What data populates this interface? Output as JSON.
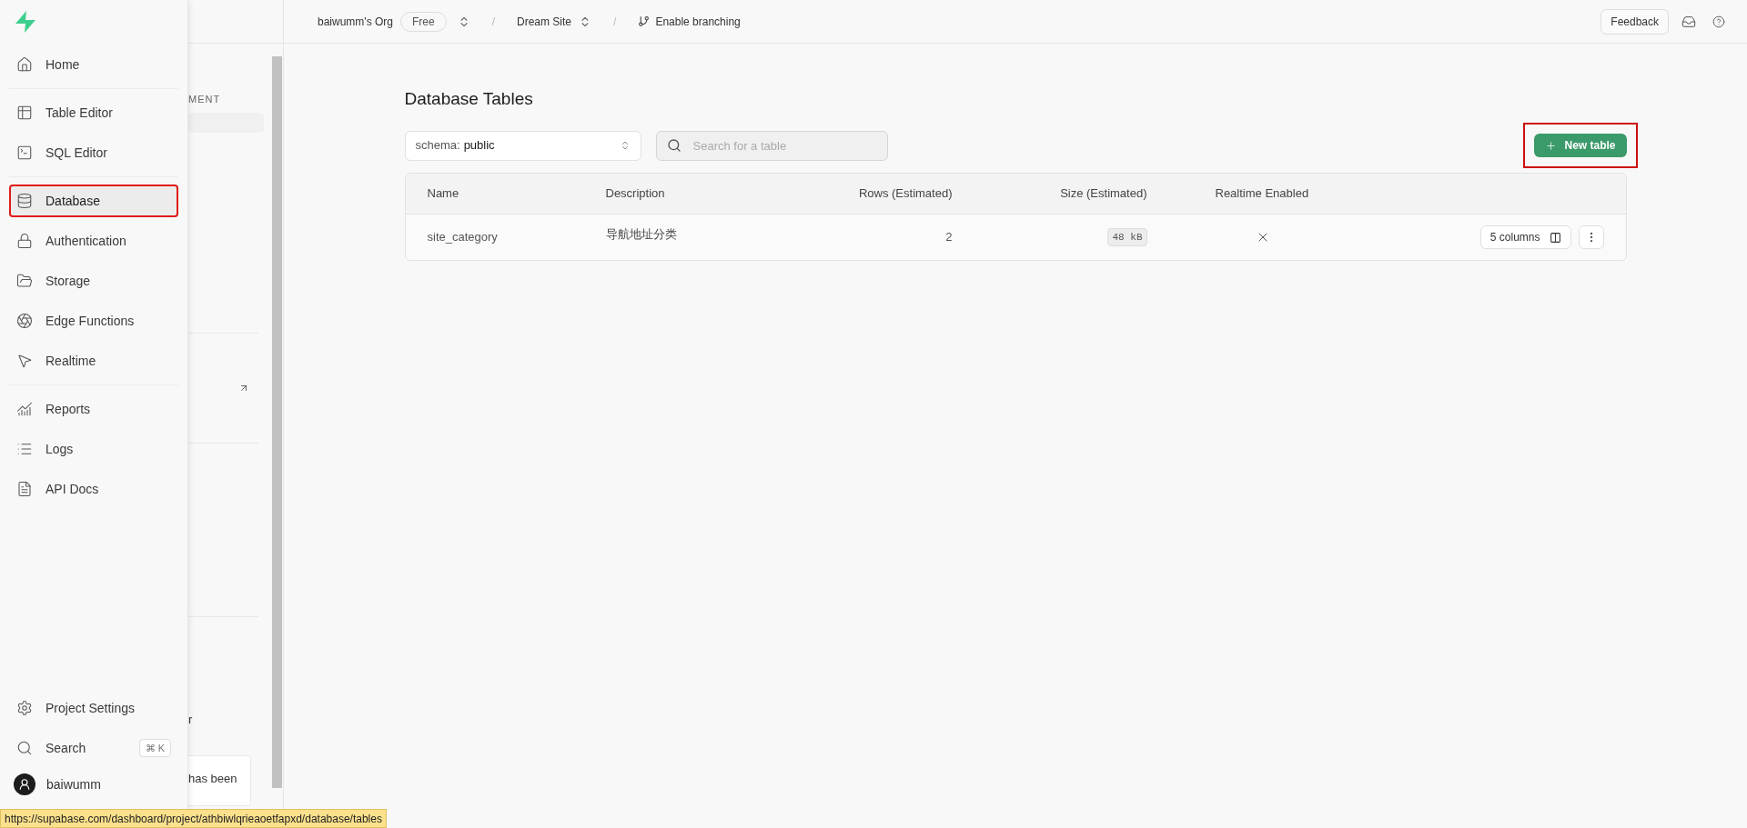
{
  "sidebar": {
    "groups": [
      [
        {
          "label": "Home",
          "selected": false,
          "outlined": false
        }
      ],
      [
        {
          "label": "Table Editor",
          "selected": false,
          "outlined": false
        },
        {
          "label": "SQL Editor",
          "selected": false,
          "outlined": false
        }
      ],
      [
        {
          "label": "Database",
          "selected": true,
          "outlined": true
        },
        {
          "label": "Authentication",
          "selected": false,
          "outlined": false
        },
        {
          "label": "Storage",
          "selected": false,
          "outlined": false
        },
        {
          "label": "Edge Functions",
          "selected": false,
          "outlined": false
        },
        {
          "label": "Realtime",
          "selected": false,
          "outlined": false
        }
      ],
      [
        {
          "label": "Reports",
          "selected": false,
          "outlined": false
        },
        {
          "label": "Logs",
          "selected": false,
          "outlined": false
        },
        {
          "label": "API Docs",
          "selected": false,
          "outlined": false
        }
      ]
    ],
    "settings": "Project Settings",
    "search": {
      "label": "Search",
      "shortcut": "⌘ K"
    },
    "user": "baiwumm"
  },
  "side_panel": {
    "section_label": "MENT",
    "text_1": "r",
    "notice": "has been"
  },
  "top_bar": {
    "org": "baiwumm's Org",
    "plan": "Free",
    "separators": [
      "/",
      "/"
    ],
    "project": "Dream Site",
    "branching": "Enable branching",
    "feedback": "Feedback"
  },
  "page": {
    "title": "Database Tables",
    "schema": {
      "label": "schema:",
      "value": "public"
    },
    "search": {
      "placeholder": "Search for a table"
    },
    "new_table": {
      "label": "New table",
      "outlined": true
    },
    "table": {
      "columns": [
        "Name",
        "Description",
        "Rows (Estimated)",
        "Size (Estimated)",
        "Realtime Enabled"
      ],
      "rows": [
        {
          "name": "site_category",
          "description": "导航地址分类",
          "rows": "2",
          "size": "48 kB",
          "realtime_enabled": false,
          "columns_button": "5 columns"
        }
      ]
    }
  },
  "status_bar": {
    "url": "https://supabase.com/dashboard/project/athbiwlqrieaoetfapxd/database/tables"
  }
}
